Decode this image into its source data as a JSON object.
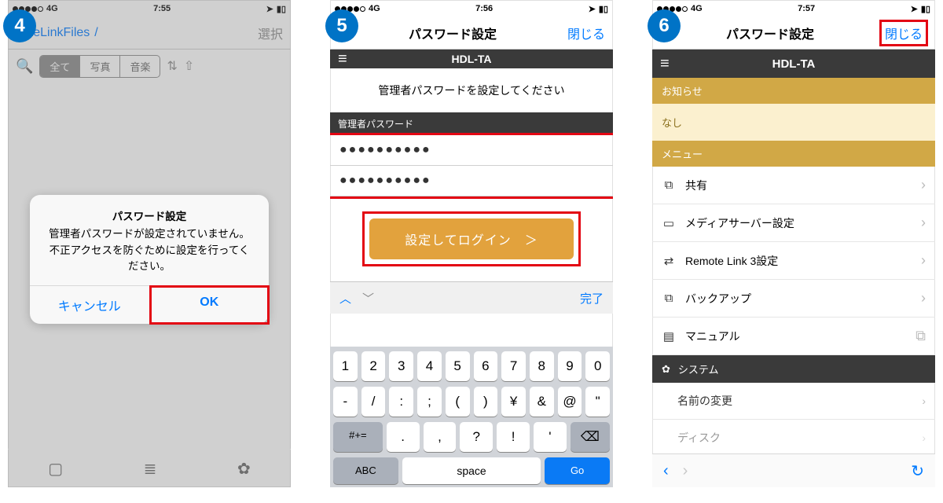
{
  "badges": {
    "p1": "4",
    "p2": "5",
    "p3": "6"
  },
  "screen1": {
    "status": {
      "carrier": "4G",
      "time": "7:55"
    },
    "nav": {
      "title": "noteLinkFiles",
      "crumb": "/",
      "right": "選択"
    },
    "filter": {
      "tabs": [
        "全て",
        "写真",
        "音楽"
      ],
      "selected": 0
    },
    "dialog": {
      "title": "パスワード設定",
      "body": "管理者パスワードが設定されていません。不正アクセスを防ぐために設定を行ってください。",
      "cancel": "キャンセル",
      "ok": "OK"
    }
  },
  "screen2": {
    "status": {
      "carrier": "4G",
      "time": "7:56"
    },
    "nav": {
      "title": "パスワード設定",
      "close": "閉じる"
    },
    "device": "HDL-TA",
    "prompt": "管理者パスワードを設定してください",
    "field_label": "管理者パスワード",
    "pw1": "●●●●●●●●●●",
    "pw2": "●●●●●●●●●●",
    "submit": "設定してログイン　＞",
    "kbar_done": "完了",
    "keyboard": {
      "row1": [
        "1",
        "2",
        "3",
        "4",
        "5",
        "6",
        "7",
        "8",
        "9",
        "0"
      ],
      "row2": [
        "-",
        "/",
        ":",
        ";",
        "(",
        ")",
        "¥",
        "&",
        "@",
        "\""
      ],
      "row3_shift": "#+=",
      "row3": [
        ".",
        ",",
        "?",
        "!",
        "'"
      ],
      "row3_bk": "⌫",
      "row4_abc": "ABC",
      "row4_space": "space",
      "row4_go": "Go"
    }
  },
  "screen3": {
    "status": {
      "carrier": "4G",
      "time": "7:57"
    },
    "nav": {
      "title": "パスワード設定",
      "close": "閉じる"
    },
    "device": "HDL-TA",
    "notice_label": "お知らせ",
    "notice_body": "なし",
    "menu_label": "メニュー",
    "menu": [
      {
        "icon": "sitemap",
        "label": "共有"
      },
      {
        "icon": "display",
        "label": "メディアサーバー設定"
      },
      {
        "icon": "link",
        "label": "Remote Link 3設定"
      },
      {
        "icon": "sitemap",
        "label": "バックアップ"
      },
      {
        "icon": "doc",
        "label": "マニュアル",
        "ext": true
      }
    ],
    "system_label": "システム",
    "system": [
      {
        "label": "名前の変更"
      },
      {
        "label": "ディスク"
      }
    ]
  }
}
